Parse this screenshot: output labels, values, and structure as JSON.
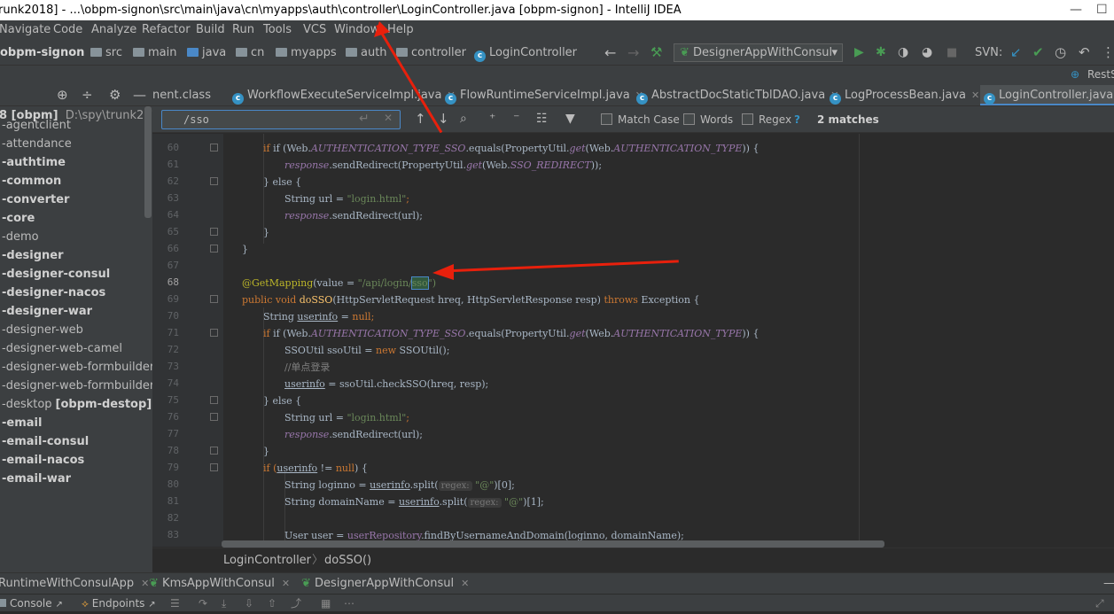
{
  "window": {
    "title": "runk2018] - ...\\obpm-signon\\src\\main\\java\\cn\\myapps\\auth\\controller\\LoginController.java [obpm-signon] - IntelliJ IDEA"
  },
  "menu": [
    "Navigate",
    "Code",
    "Analyze",
    "Refactor",
    "Build",
    "Run",
    "Tools",
    "VCS",
    "Window",
    "Help"
  ],
  "nav": {
    "project": "obpm-signon",
    "crumbs": [
      "src",
      "main",
      "java",
      "cn",
      "myapps",
      "auth",
      "controller"
    ],
    "file": "LoginController",
    "run_config": "DesignerAppWithConsul",
    "svn": "SVN:",
    "rest": "RestSe"
  },
  "project_panel": {
    "root_name": "8 [obpm]",
    "root_path": "D:\\spy\\trunk2018",
    "modules": [
      {
        "label": "-agentclient",
        "bold": false
      },
      {
        "label": "-attendance",
        "bold": false
      },
      {
        "label": "-authtime",
        "bold": true
      },
      {
        "label": "-common",
        "bold": true
      },
      {
        "label": "-converter",
        "bold": true
      },
      {
        "label": "-core",
        "bold": true
      },
      {
        "label": "-demo",
        "bold": false
      },
      {
        "label": "-designer",
        "bold": true
      },
      {
        "label": "-designer-consul",
        "bold": true
      },
      {
        "label": "-designer-nacos",
        "bold": true
      },
      {
        "label": "-designer-war",
        "bold": true
      },
      {
        "label": "-designer-web",
        "bold": false
      },
      {
        "label": "-designer-web-camel",
        "bold": false
      },
      {
        "label": "-designer-web-formbuilder",
        "bold": false
      },
      {
        "label": "-designer-web-formbuilder2",
        "bold": false
      },
      {
        "label": "-desktop",
        "bold": false,
        "suffix": "[obpm-destop]"
      },
      {
        "label": "-email",
        "bold": true
      },
      {
        "label": "-email-consul",
        "bold": true
      },
      {
        "label": "-email-nacos",
        "bold": true
      },
      {
        "label": "-email-war",
        "bold": true
      }
    ]
  },
  "tabs": [
    {
      "label": "nent.class",
      "active": false
    },
    {
      "label": "WorkflowExecuteServiceImpl.java",
      "active": false
    },
    {
      "label": "FlowRuntimeServiceImpl.java",
      "active": false
    },
    {
      "label": "AbstractDocStaticTblDAO.java",
      "active": false
    },
    {
      "label": "LogProcessBean.java",
      "active": false
    },
    {
      "label": "LoginController.java",
      "active": true
    }
  ],
  "search": {
    "query": "/sso",
    "match_case": "Match Case",
    "words": "Words",
    "regex": "Regex",
    "help": "?",
    "matches": "2 matches"
  },
  "line_numbers": [
    "60",
    "61",
    "62",
    "63",
    "64",
    "65",
    "66",
    "67",
    "68",
    "69",
    "70",
    "71",
    "72",
    "73",
    "74",
    "75",
    "76",
    "77",
    "78",
    "79",
    "80",
    "81",
    "82",
    "83"
  ],
  "code_text": {
    "l60a": "if (Web.",
    "l60b": "AUTHENTICATION_TYPE_SSO",
    "l60c": ".equals(PropertyUtil.",
    "l60d": "get",
    "l60e": "(Web.",
    "l60f": "AUTHENTICATION_TYPE",
    "l60g": ")) {",
    "l61a": "response",
    "l61b": ".sendRedirect(PropertyUtil.",
    "l61c": "get",
    "l61d": "(Web.",
    "l61e": "SSO_REDIRECT",
    "l61f": "));",
    "l62": "} else {",
    "l63a": "String url = ",
    "l63b": "\"login.html\"",
    "l63c": ";",
    "l64a": "response",
    "l64b": ".sendRedirect(url);",
    "l65": "}",
    "l66": "}",
    "l68a": "@GetMapping",
    "l68b": "(value = ",
    "l68c": "\"/api/login/",
    "l68d": "sso",
    "l68e": "\")",
    "l69a": "public void ",
    "l69b": "doSSO",
    "l69c": "(HttpServletRequest hreq, HttpServletResponse resp) ",
    "l69d": "throws ",
    "l69e": "Exception {",
    "l70a": "String ",
    "l70b": "userinfo",
    "l70c": " = ",
    "l70d": "null",
    "l70e": ";",
    "l71a": "if (Web.",
    "l71b": "AUTHENTICATION_TYPE_SSO",
    "l71c": ".equals(PropertyUtil.",
    "l71d": "get",
    "l71e": "(Web.",
    "l71f": "AUTHENTICATION_TYPE",
    "l71g": ")) {",
    "l72a": "SSOUtil ssoUtil = ",
    "l72b": "new ",
    "l72c": "SSOUtil();",
    "l73": "//单点登录",
    "l74a": "userinfo",
    "l74b": " = ssoUtil.checkSSO(hreq, resp);",
    "l75": "} else {",
    "l76a": "String url = ",
    "l76b": "\"login.html\"",
    "l76c": ";",
    "l77a": "response",
    "l77b": ".sendRedirect(url);",
    "l78": "}",
    "l79a": "if (",
    "l79b": "userinfo",
    "l79c": " != ",
    "l79d": "null",
    "l79e": ") {",
    "l80a": "String loginno = ",
    "l80b": "userinfo",
    "l80c": ".split(",
    "l80d": "regex:",
    "l80e": " \"@\"",
    "l80f": ")[0];",
    "l81a": "String domainName = ",
    "l81b": "userinfo",
    "l81c": ".split(",
    "l81d": "regex:",
    "l81e": " \"@\"",
    "l81f": ")[1];",
    "l83a": "User user = ",
    "l83b": "userRepository",
    "l83c": ".findByUsernameAndDomain(loginno, domainName);"
  },
  "editor_breadcrumb": [
    "LoginController",
    "doSSO()"
  ],
  "run_tabs": [
    "RuntimeWithConsulApp",
    "KmsAppWithConsul",
    "DesignerAppWithConsul"
  ],
  "bottom_tabs": [
    "Console",
    "Endpoints"
  ],
  "colors": {
    "accent": "#4a88c7",
    "arrow": "#e8200c",
    "keyword": "#cc7832",
    "string": "#6a8759"
  }
}
